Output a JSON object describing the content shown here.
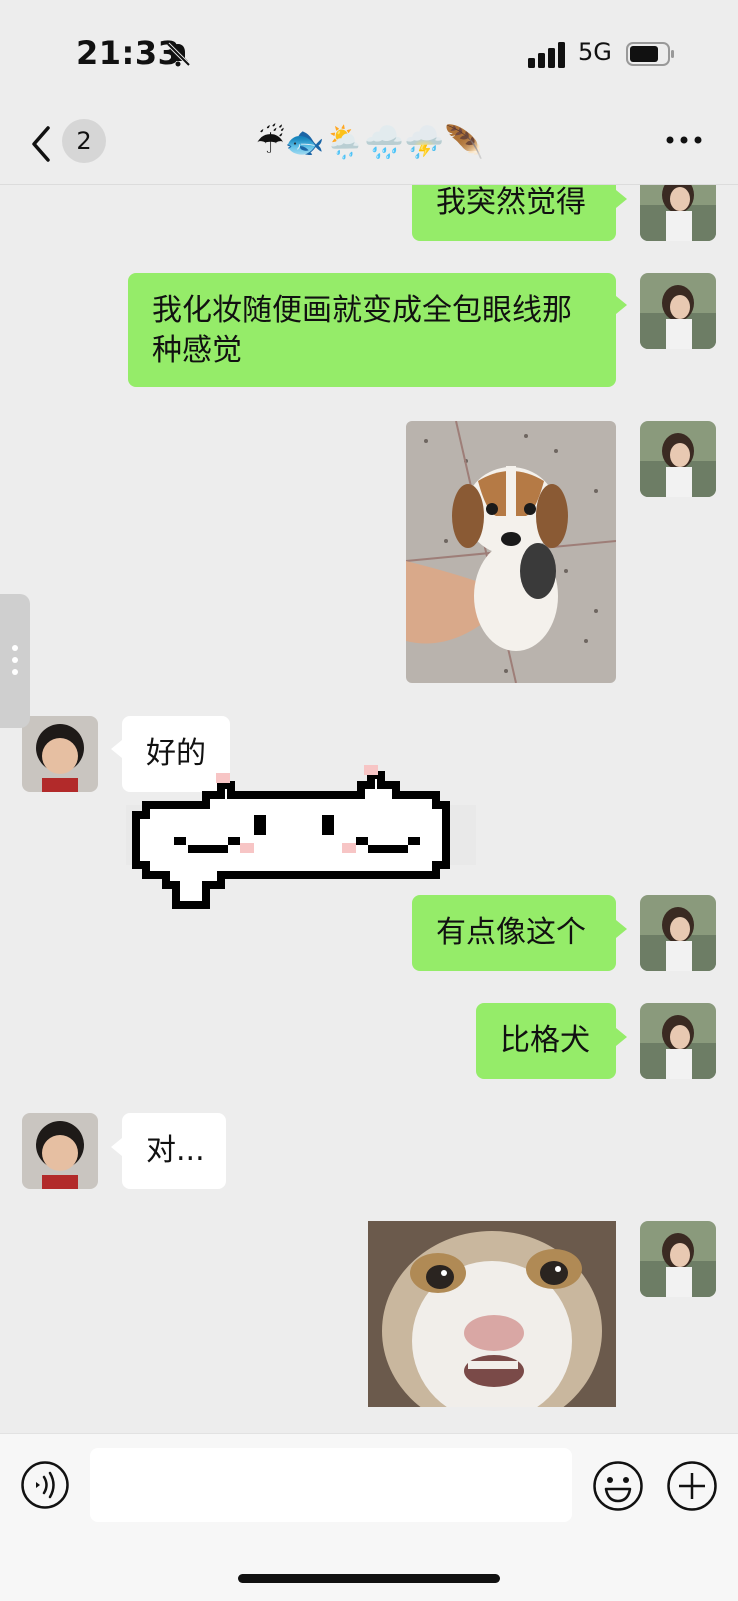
{
  "status": {
    "time": "21:33",
    "network": "5G"
  },
  "nav": {
    "unread_count": "2",
    "title": "☔🐟🌦️🌧️⛈️🪶"
  },
  "messages": [
    {
      "from": "me",
      "text": "我突然觉得"
    },
    {
      "from": "me",
      "text": "我化妆随便画就变成全包眼线那种感觉"
    },
    {
      "from": "me",
      "type": "image",
      "icon": "beagle-puppy-photo"
    },
    {
      "from": "them",
      "text": "好的"
    },
    {
      "from": "them",
      "type": "sticker",
      "icon": "pixel-cat-sticker"
    },
    {
      "from": "me",
      "text": "有点像这个"
    },
    {
      "from": "me",
      "text": "比格犬"
    },
    {
      "from": "them",
      "text": "对..."
    },
    {
      "from": "me",
      "type": "image",
      "icon": "cat-face-photo"
    }
  ],
  "colors": {
    "my_bubble": "#95EC69",
    "their_bubble": "#FFFFFF",
    "background": "#EDEDED"
  }
}
